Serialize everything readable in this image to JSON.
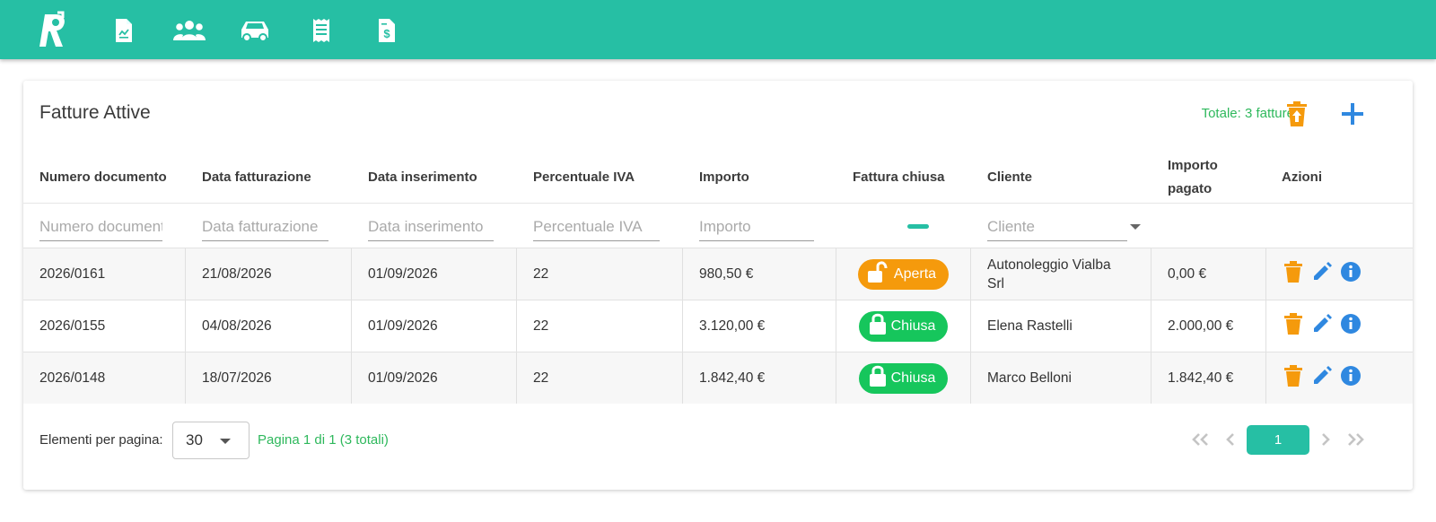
{
  "nav": {
    "items": [
      {
        "icon": "invoice-document-icon"
      },
      {
        "icon": "users-group-icon"
      },
      {
        "icon": "car-icon"
      },
      {
        "icon": "receipt-icon"
      },
      {
        "icon": "invoice-dollar-icon"
      }
    ]
  },
  "card": {
    "title": "Fatture Attive",
    "total": "Totale: 3 fatture"
  },
  "columns": {
    "numero": "Numero documento",
    "data_fatt": "Data fatturazione",
    "data_ins": "Data inserimento",
    "iva": "Percentuale IVA",
    "importo": "Importo",
    "chiusa": "Fattura chiusa",
    "cliente": "Cliente",
    "pagato": "Importo pagato",
    "azioni": "Azioni"
  },
  "filters": {
    "numero": "Numero documento",
    "data_fatt": "Data fatturazione",
    "data_ins": "Data inserimento",
    "iva": "Percentuale IVA",
    "importo": "Importo",
    "cliente": "Cliente"
  },
  "rows": [
    {
      "numero": "2026/0161",
      "data_fatt": "21/08/2026",
      "data_ins": "01/09/2026",
      "iva": "22",
      "importo": "980,50 €",
      "stato": "Aperta",
      "cliente": "Autonoleggio Vialba Srl",
      "pagato": "0,00 €"
    },
    {
      "numero": "2026/0155",
      "data_fatt": "04/08/2026",
      "data_ins": "01/09/2026",
      "iva": "22",
      "importo": "3.120,00 €",
      "stato": "Chiusa",
      "cliente": "Elena Rastelli",
      "pagato": "2.000,00 €"
    },
    {
      "numero": "2026/0148",
      "data_fatt": "18/07/2026",
      "data_ins": "01/09/2026",
      "iva": "22",
      "importo": "1.842,40 €",
      "stato": "Chiusa",
      "cliente": "Marco Belloni",
      "pagato": "1.842,40 €"
    }
  ],
  "footer": {
    "per_page_label": "Elementi per pagina:",
    "per_page_value": "30",
    "page_info": "Pagina 1 di 1 (3 totali)",
    "current_page": "1"
  },
  "colors": {
    "primary": "#26bfa4",
    "open": "#f59a0c",
    "closed": "#16c65c",
    "delete": "#f59a0c",
    "edit": "#2f88e0",
    "info": "#2f88e0",
    "total_text": "#2eb85c"
  }
}
